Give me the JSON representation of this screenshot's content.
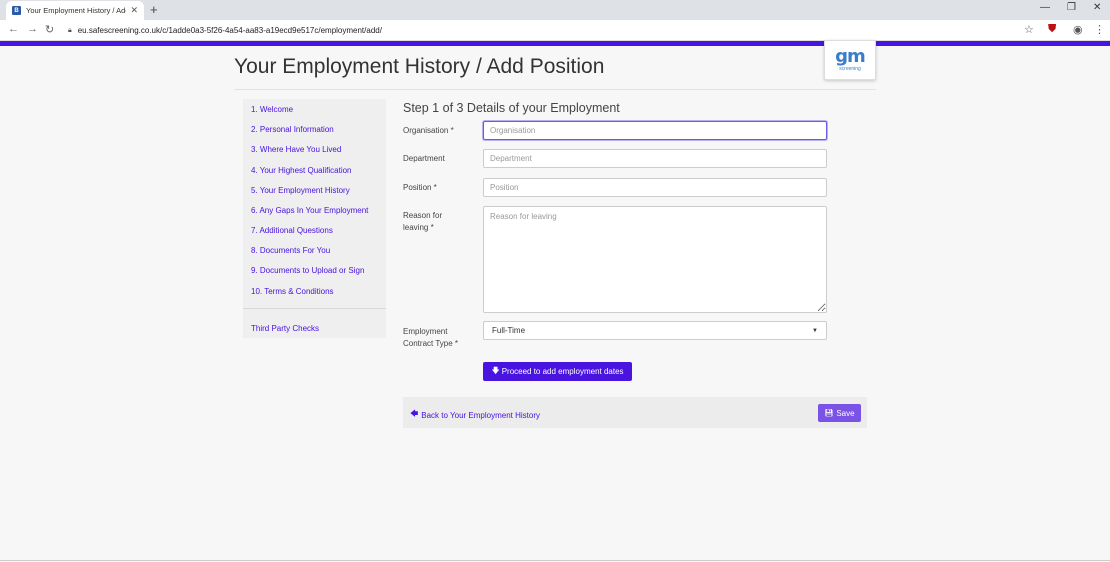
{
  "browser": {
    "tab_title": "Your Employment History / Add",
    "tab_favicon": "B",
    "url": "eu.safescreening.co.uk/c/1adde0a3-5f26-4a54-aa83-a19ecd9e517c/employment/add/"
  },
  "page": {
    "title": "Your Employment History / Add Position"
  },
  "logo": {
    "mark": "gm",
    "sub": "screening"
  },
  "sidebar": {
    "items": [
      "1. Welcome",
      "2. Personal Information",
      "3. Where Have You Lived",
      "4. Your Highest Qualification",
      "5. Your Employment History",
      "6. Any Gaps In Your Employment",
      "7. Additional Questions",
      "8. Documents For You",
      "9. Documents to Upload or Sign",
      "10. Terms & Conditions"
    ],
    "third_party": "Third Party Checks"
  },
  "form": {
    "step_title": "Step 1 of 3 Details of your Employment",
    "organisation_label": "Organisation *",
    "organisation_placeholder": "Organisation",
    "department_label": "Department",
    "department_placeholder": "Department",
    "position_label": "Position *",
    "position_placeholder": "Position",
    "reason_label": "Reason for leaving *",
    "reason_placeholder": "Reason for leaving",
    "contract_label": "Employment Contract Type *",
    "contract_value": "Full-Time",
    "proceed_label": "Proceed to add employment dates"
  },
  "footer": {
    "back_label": "Back to Your Employment History",
    "save_label": "Save"
  },
  "colors": {
    "accent": "#4a14e0",
    "save": "#7b52e6"
  }
}
